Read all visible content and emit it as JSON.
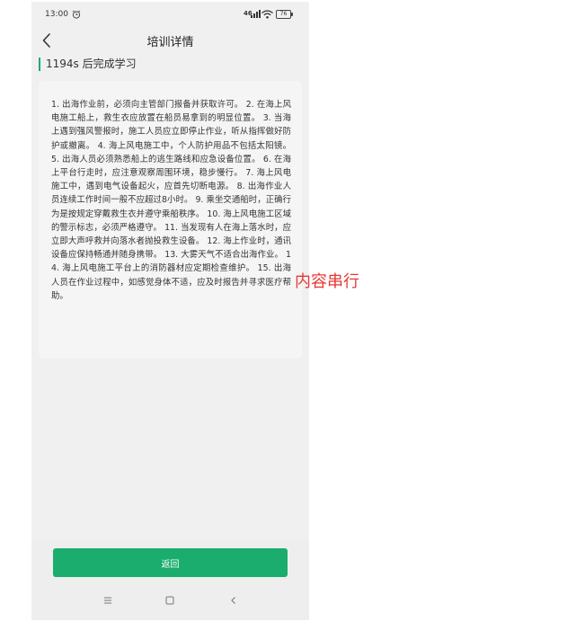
{
  "status_bar": {
    "time": "13:00",
    "signal": "46",
    "battery": "76"
  },
  "header": {
    "title": "培训详情"
  },
  "countdown": "1194s 后完成学习",
  "content": "1. 出海作业前，必须向主管部门报备并获取许可。 2. 在海上风电施工船上，救生衣应放置在船员易拿到的明显位置。 3. 当海上遇到强风警报时，施工人员应立即停止作业，听从指挥做好防护或撤离。 4. 海上风电施工中，个人防护用品不包括太阳镜。 5. 出海人员必须熟悉船上的逃生路线和应急设备位置。 6. 在海上平台行走时，应注意观察周围环境，稳步慢行。 7. 海上风电施工中，遇到电气设备起火，应首先切断电源。 8. 出海作业人员连续工作时间一般不应超过8小时。 9. 乘坐交通船时，正确行为是按规定穿戴救生衣并遵守乘船秩序。 10. 海上风电施工区域的警示标志，必须严格遵守。 11. 当发现有人在海上落水时，应立即大声呼救并向落水者抛投救生设备。 12. 海上作业时，通讯设备应保持畅通并随身携带。 13. 大雾天气不适合出海作业。 14. 海上风电施工平台上的消防器材应定期检查维护。 15. 出海人员在作业过程中，如感觉身体不适，应及时报告并寻求医疗帮助。",
  "footer": {
    "return_label": "返回"
  },
  "annotation": "内容串行"
}
